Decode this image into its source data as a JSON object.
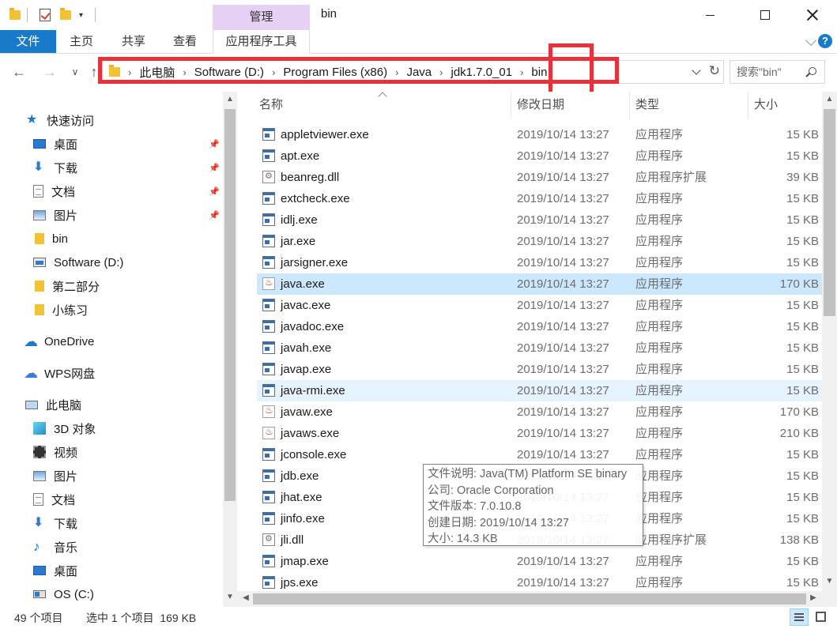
{
  "window": {
    "title": "bin",
    "manage_tab": "管理"
  },
  "ribbon": {
    "tabs": [
      {
        "label": "文件"
      },
      {
        "label": "主页"
      },
      {
        "label": "共享"
      },
      {
        "label": "查看"
      },
      {
        "label": "应用程序工具"
      }
    ]
  },
  "address": {
    "crumbs": [
      "此电脑",
      "Software (D:)",
      "Program Files (x86)",
      "Java",
      "jdk1.7.0_01",
      "bin"
    ],
    "search_placeholder": "搜索\"bin\""
  },
  "nav": {
    "items": [
      {
        "label": "快速访问",
        "icon": "star-icon"
      },
      {
        "label": "桌面",
        "icon": "desktop-icon",
        "pinned": true
      },
      {
        "label": "下载",
        "icon": "download-icon",
        "pinned": true
      },
      {
        "label": "文档",
        "icon": "document-icon",
        "pinned": true
      },
      {
        "label": "图片",
        "icon": "picture-icon",
        "pinned": true
      },
      {
        "label": "bin",
        "icon": "folder-icon"
      },
      {
        "label": "Software (D:)",
        "icon": "drive-icon"
      },
      {
        "label": "第二部分",
        "icon": "folder-icon"
      },
      {
        "label": "小练习",
        "icon": "folder-icon"
      },
      {
        "label": "OneDrive",
        "icon": "cloud-icon"
      },
      {
        "label": "WPS网盘",
        "icon": "wps-cloud-icon"
      },
      {
        "label": "此电脑",
        "icon": "computer-icon"
      },
      {
        "label": "3D 对象",
        "icon": "cube-icon"
      },
      {
        "label": "视频",
        "icon": "video-icon"
      },
      {
        "label": "图片",
        "icon": "picture-icon"
      },
      {
        "label": "文档",
        "icon": "document-icon"
      },
      {
        "label": "下载",
        "icon": "download-icon"
      },
      {
        "label": "音乐",
        "icon": "music-icon"
      },
      {
        "label": "桌面",
        "icon": "desktop-icon"
      },
      {
        "label": "OS (C:)",
        "icon": "os-drive-icon"
      }
    ]
  },
  "columns": {
    "name": "名称",
    "date": "修改日期",
    "type": "类型",
    "size": "大小"
  },
  "files": [
    {
      "name": "appletviewer.exe",
      "date": "2019/10/14 13:27",
      "type": "应用程序",
      "size": "15 KB",
      "icon": "exe"
    },
    {
      "name": "apt.exe",
      "date": "2019/10/14 13:27",
      "type": "应用程序",
      "size": "15 KB",
      "icon": "exe"
    },
    {
      "name": "beanreg.dll",
      "date": "2019/10/14 13:27",
      "type": "应用程序扩展",
      "size": "39 KB",
      "icon": "dll"
    },
    {
      "name": "extcheck.exe",
      "date": "2019/10/14 13:27",
      "type": "应用程序",
      "size": "15 KB",
      "icon": "exe"
    },
    {
      "name": "idlj.exe",
      "date": "2019/10/14 13:27",
      "type": "应用程序",
      "size": "15 KB",
      "icon": "exe"
    },
    {
      "name": "jar.exe",
      "date": "2019/10/14 13:27",
      "type": "应用程序",
      "size": "15 KB",
      "icon": "exe"
    },
    {
      "name": "jarsigner.exe",
      "date": "2019/10/14 13:27",
      "type": "应用程序",
      "size": "15 KB",
      "icon": "exe"
    },
    {
      "name": "java.exe",
      "date": "2019/10/14 13:27",
      "type": "应用程序",
      "size": "170 KB",
      "icon": "java",
      "state": "selected"
    },
    {
      "name": "javac.exe",
      "date": "2019/10/14 13:27",
      "type": "应用程序",
      "size": "15 KB",
      "icon": "exe"
    },
    {
      "name": "javadoc.exe",
      "date": "2019/10/14 13:27",
      "type": "应用程序",
      "size": "15 KB",
      "icon": "exe"
    },
    {
      "name": "javah.exe",
      "date": "2019/10/14 13:27",
      "type": "应用程序",
      "size": "15 KB",
      "icon": "exe"
    },
    {
      "name": "javap.exe",
      "date": "2019/10/14 13:27",
      "type": "应用程序",
      "size": "15 KB",
      "icon": "exe"
    },
    {
      "name": "java-rmi.exe",
      "date": "2019/10/14 13:27",
      "type": "应用程序",
      "size": "15 KB",
      "icon": "exe",
      "state": "hover"
    },
    {
      "name": "javaw.exe",
      "date": "2019/10/14 13:27",
      "type": "应用程序",
      "size": "170 KB",
      "icon": "java"
    },
    {
      "name": "javaws.exe",
      "date": "2019/10/14 13:27",
      "type": "应用程序",
      "size": "210 KB",
      "icon": "java"
    },
    {
      "name": "jconsole.exe",
      "date": "2019/10/14 13:27",
      "type": "应用程序",
      "size": "15 KB",
      "icon": "exe"
    },
    {
      "name": "jdb.exe",
      "date": "2019/10/14 13:27",
      "type": "应用程序",
      "size": "15 KB",
      "icon": "exe"
    },
    {
      "name": "jhat.exe",
      "date": "2019/10/14 13:27",
      "type": "应用程序",
      "size": "15 KB",
      "icon": "exe"
    },
    {
      "name": "jinfo.exe",
      "date": "2019/10/14 13:27",
      "type": "应用程序",
      "size": "15 KB",
      "icon": "exe"
    },
    {
      "name": "jli.dll",
      "date": "2019/10/14 13:27",
      "type": "应用程序扩展",
      "size": "138 KB",
      "icon": "dll"
    },
    {
      "name": "jmap.exe",
      "date": "2019/10/14 13:27",
      "type": "应用程序",
      "size": "15 KB",
      "icon": "exe"
    },
    {
      "name": "jps.exe",
      "date": "2019/10/14 13:27",
      "type": "应用程序",
      "size": "15 KB",
      "icon": "exe"
    }
  ],
  "tooltip": {
    "lines": [
      "文件说明: Java(TM) Platform SE binary",
      "公司: Oracle Corporation",
      "文件版本: 7.0.10.8",
      "创建日期: 2019/10/14 13:27",
      "大小: 14.3 KB"
    ]
  },
  "status": {
    "count": "49 个项目",
    "selection": "选中 1 个项目  169 KB"
  },
  "colors": {
    "accent": "#1979ca",
    "manage_tab": "#e6d1f5",
    "selected_row": "#cce8ff",
    "hover_row": "#e5f3ff",
    "highlight_box": "#e8313a"
  }
}
